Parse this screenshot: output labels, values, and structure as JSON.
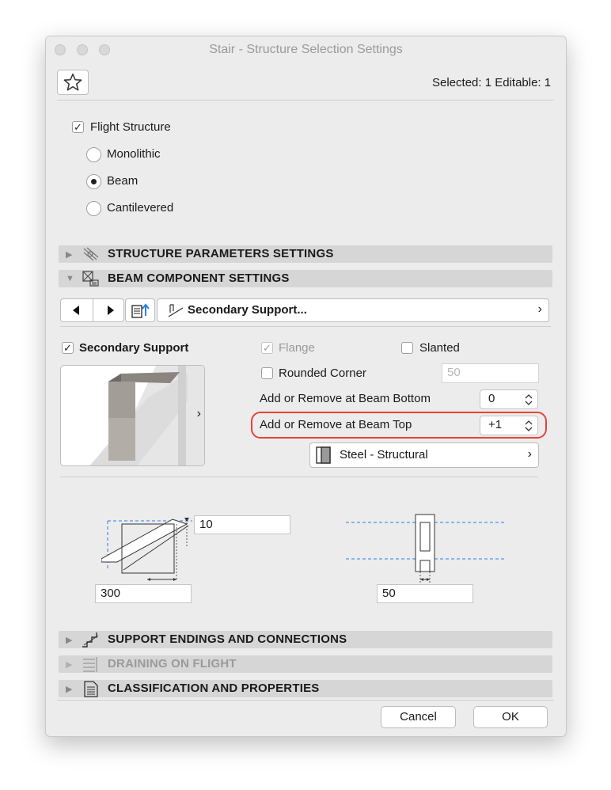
{
  "window": {
    "title": "Stair - Structure Selection Settings"
  },
  "header": {
    "selected_text": "Selected: 1 Editable: 1"
  },
  "flight": {
    "checkbox_label": "Flight Structure",
    "options": [
      "Monolithic",
      "Beam",
      "Cantilevered"
    ],
    "selected": "Beam"
  },
  "sections": {
    "structure_params": "STRUCTURE PARAMETERS SETTINGS",
    "beam_component": "BEAM COMPONENT SETTINGS",
    "support_endings": "SUPPORT ENDINGS AND CONNECTIONS",
    "draining": "DRAINING ON FLIGHT",
    "classification": "CLASSIFICATION AND PROPERTIES"
  },
  "component_nav": {
    "selector_label": "Secondary Support..."
  },
  "secondary": {
    "checkbox_label": "Secondary Support",
    "flange_label": "Flange",
    "slanted_label": "Slanted",
    "rounded_label": "Rounded Corner",
    "rounded_value": "50",
    "beam_bottom_label": "Add or Remove at Beam Bottom",
    "beam_bottom_value": "0",
    "beam_top_label": "Add or Remove at Beam Top",
    "beam_top_value": "+1",
    "material_label": "Steel - Structural"
  },
  "dimensions": {
    "top_offset": "10",
    "width": "300",
    "thickness": "50"
  },
  "footer": {
    "cancel_label": "Cancel",
    "ok_label": "OK"
  },
  "colors": {
    "highlight": "#e8423a",
    "accent": "#2b7de9"
  }
}
